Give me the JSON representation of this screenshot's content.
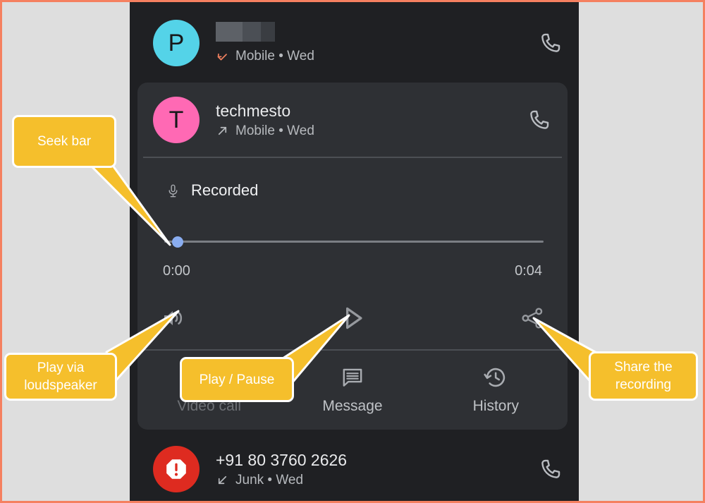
{
  "theme": {
    "page_border_color": "#f58060",
    "page_background": "#dedede",
    "phone_background": "#1f2023",
    "card_background": "#2e3034",
    "callout_fill": "#f5bf2c",
    "callout_border": "#ffffff",
    "seek_thumb_color": "#8aadf0",
    "seek_track_color": "#7b7e84"
  },
  "call_list": {
    "rows": [
      {
        "id": "row-redacted",
        "avatar_letter": "P",
        "avatar_color": "#54d3e8",
        "name_redacted": true,
        "name": "",
        "direction_icon": "missed-call-icon",
        "subtitle": "Mobile • Wed",
        "action_icon": "phone-call-icon"
      },
      {
        "id": "row-junk",
        "avatar_letter": "",
        "avatar_color": "#de2b20",
        "avatar_icon": "spam-report-icon",
        "name_redacted": false,
        "name": "+91 80 3760 2626",
        "direction_icon": "incoming-call-icon",
        "subtitle": "Junk • Wed",
        "action_icon": "phone-call-icon"
      }
    ]
  },
  "expanded_card": {
    "contact": {
      "avatar_letter": "T",
      "avatar_color": "#ff69b4",
      "name": "techmesto",
      "direction_icon": "outgoing-call-icon",
      "subtitle": "Mobile • Wed",
      "action_icon": "phone-call-icon"
    },
    "recording": {
      "mic_icon": "microphone-icon",
      "label": "Recorded",
      "elapsed_time": "0:00",
      "total_time": "0:04",
      "progress_percent": 0
    },
    "media_controls": [
      {
        "id": "speaker",
        "icon": "loudspeaker-icon",
        "name": "speaker-button"
      },
      {
        "id": "play",
        "icon": "play-icon",
        "name": "play-pause-button"
      },
      {
        "id": "share",
        "icon": "share-icon",
        "name": "share-button"
      }
    ],
    "actions": [
      {
        "id": "video-call",
        "icon": "video-call-icon",
        "label": "Video call",
        "disabled": true
      },
      {
        "id": "message",
        "icon": "message-icon",
        "label": "Message",
        "disabled": false
      },
      {
        "id": "history",
        "icon": "history-icon",
        "label": "History",
        "disabled": false
      }
    ]
  },
  "callouts": [
    {
      "id": "seek-bar",
      "text": "Seek bar"
    },
    {
      "id": "loudspeaker",
      "text": "Play via\nloudspeaker"
    },
    {
      "id": "play-pause",
      "text": "Play / Pause"
    },
    {
      "id": "share-recording",
      "text": "Share the\nrecording"
    }
  ]
}
